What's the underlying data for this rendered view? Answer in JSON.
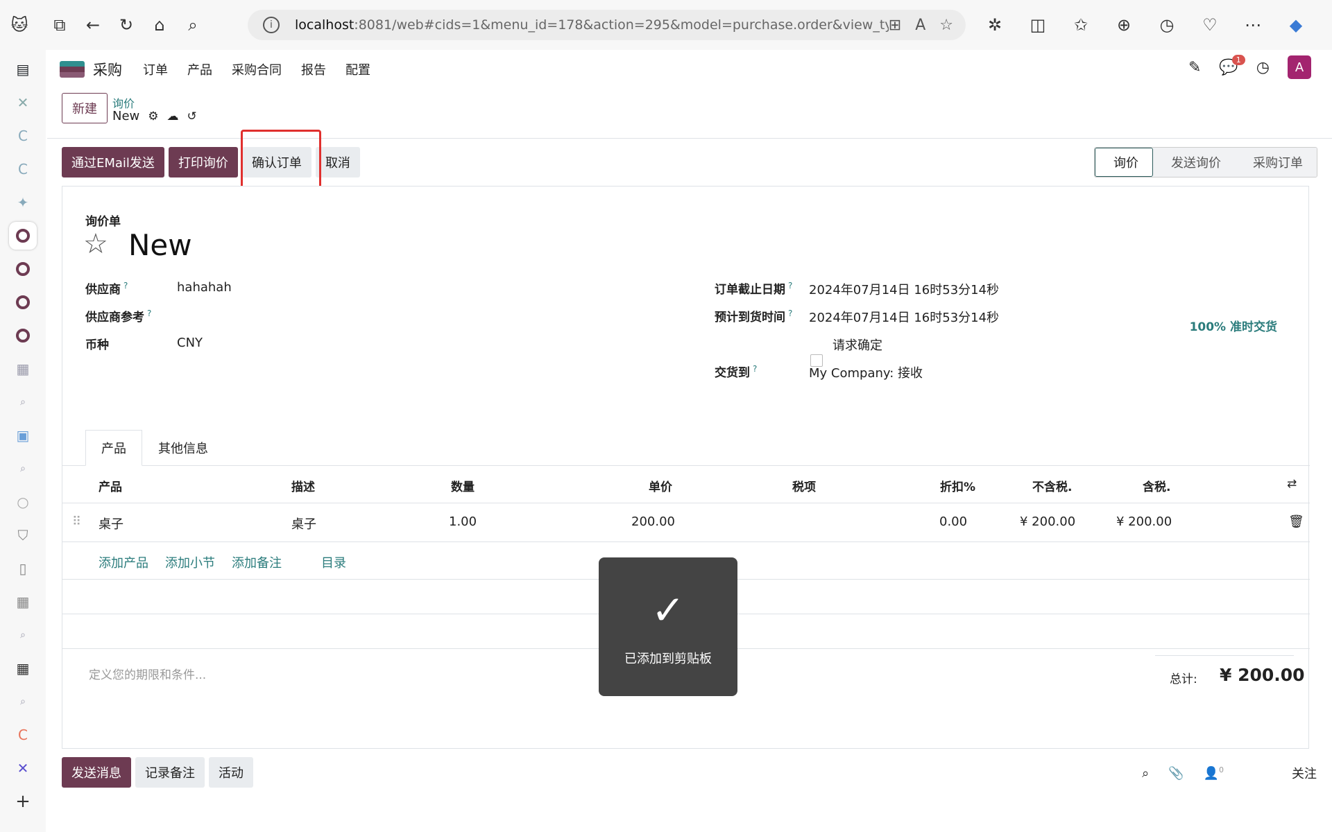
{
  "browser": {
    "url_host": "localhost",
    "url_rest": ":8081/web#cids=1&menu_id=178&action=295&model=purchase.order&view_ty..."
  },
  "app": {
    "name": "采购",
    "menu": [
      "订单",
      "产品",
      "采购合同",
      "报告",
      "配置"
    ],
    "chat_badge": "1",
    "avatar": "A"
  },
  "control": {
    "new_label": "新建",
    "breadcrumb_parent": "询价",
    "breadcrumb_current": "New"
  },
  "actions": {
    "email": "通过EMail发送",
    "print": "打印询价",
    "confirm": "确认订单",
    "cancel": "取消"
  },
  "status": {
    "stages": [
      "询价",
      "发送询价",
      "采购订单"
    ],
    "active": "询价"
  },
  "form": {
    "doc_type": "询价单",
    "title": "New",
    "vendor_label": "供应商",
    "vendor_value": "hahahah",
    "vendor_ref_label": "供应商参考",
    "currency_label": "币种",
    "currency_value": "CNY",
    "deadline_label": "订单截止日期",
    "deadline_value": "2024年07月14日 16时53分14秒",
    "arrival_label": "预计到货时间",
    "arrival_value": "2024年07月14日 16时53分14秒",
    "ontime": "100% 准时交货",
    "confirm_request": "请求确定",
    "deliver_label": "交货到",
    "deliver_value": "My Company: 接收",
    "help_mark": "?"
  },
  "tabs": [
    "产品",
    "其他信息"
  ],
  "table": {
    "headers": [
      "产品",
      "描述",
      "数量",
      "单价",
      "税项",
      "折扣%",
      "不含税.",
      "含税."
    ],
    "row": {
      "product": "桌子",
      "description": "桌子",
      "qty": "1.00",
      "price": "200.00",
      "tax": "",
      "discount": "0.00",
      "subtotal": "¥ 200.00",
      "total": "¥ 200.00"
    },
    "add_links": [
      "添加产品",
      "添加小节",
      "添加备注",
      "目录"
    ]
  },
  "footer": {
    "terms_placeholder": "定义您的期限和条件...",
    "total_label": "总计:",
    "total_value": "¥ 200.00"
  },
  "toast": {
    "message": "已添加到剪贴板"
  },
  "chatter": {
    "send": "发送消息",
    "note": "记录备注",
    "activity": "活动",
    "followers": "0",
    "follow": "关注"
  }
}
